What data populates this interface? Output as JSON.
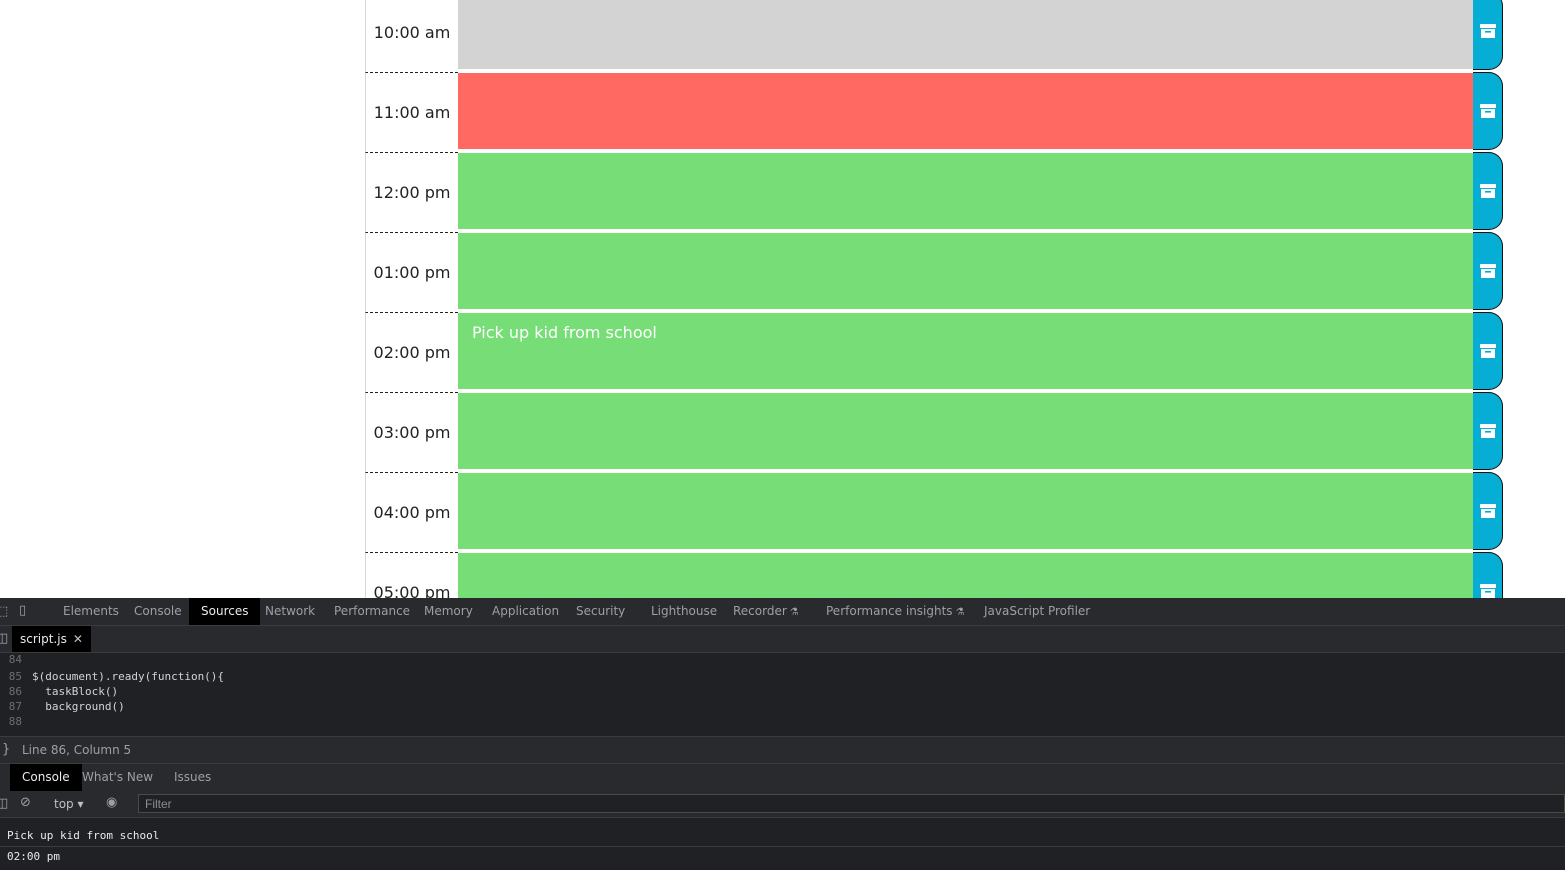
{
  "scheduler": {
    "rows": [
      {
        "hour": "10:00 am",
        "status": "past",
        "text": ""
      },
      {
        "hour": "11:00 am",
        "status": "present",
        "text": ""
      },
      {
        "hour": "12:00 pm",
        "status": "future",
        "text": ""
      },
      {
        "hour": "01:00 pm",
        "status": "future",
        "text": ""
      },
      {
        "hour": "02:00 pm",
        "status": "future",
        "text": "Pick up kid from school"
      },
      {
        "hour": "03:00 pm",
        "status": "future",
        "text": ""
      },
      {
        "hour": "04:00 pm",
        "status": "future",
        "text": ""
      },
      {
        "hour": "05:00 pm",
        "status": "future",
        "text": ""
      }
    ],
    "colors": {
      "past": "#d3d3d3",
      "present": "#ff6961",
      "future": "#77dd77",
      "save": "#06aed5"
    },
    "save_icon": "archive-icon"
  },
  "devtools": {
    "tabs": [
      "Elements",
      "Console",
      "Sources",
      "Network",
      "Performance",
      "Memory",
      "Application",
      "Security",
      "Lighthouse",
      "Recorder",
      "Performance insights",
      "JavaScript Profiler"
    ],
    "active_tab": "Sources",
    "file_tab": "script.js",
    "code_lines": [
      {
        "num": "84",
        "text": ""
      },
      {
        "num": "85",
        "text": "$(document).ready(function(){"
      },
      {
        "num": "86",
        "text": "  taskBlock()"
      },
      {
        "num": "87",
        "text": "  background()"
      },
      {
        "num": "88",
        "text": ""
      }
    ],
    "status": "Line 86, Column 5",
    "drawer_tabs": [
      "Console",
      "What's New",
      "Issues"
    ],
    "active_drawer_tab": "Console",
    "context": "top",
    "filter_placeholder": "Filter",
    "console_messages": [
      "Pick up kid from school",
      "02:00 pm"
    ]
  }
}
